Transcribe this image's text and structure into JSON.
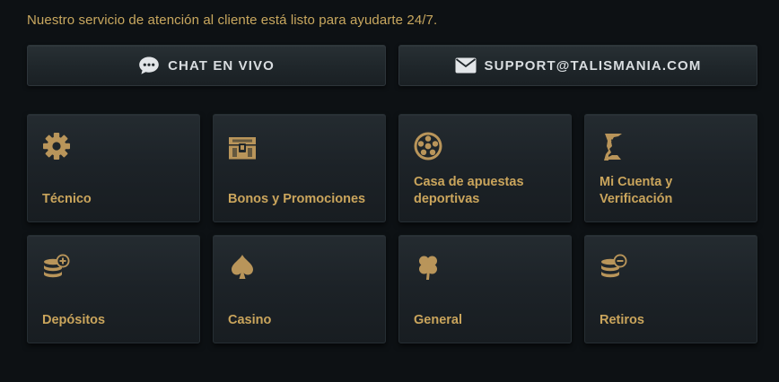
{
  "intro_text": "Nuestro servicio de atención al cliente está listo para ayudarte 24/7.",
  "contact_buttons": {
    "chat": {
      "label": "CHAT EN VIVO",
      "icon": "chat-bubble-icon"
    },
    "email": {
      "label": "SUPPORT@TALISMANIA.COM",
      "icon": "envelope-icon"
    }
  },
  "categories": [
    {
      "label": "Técnico",
      "icon": "gear-icon"
    },
    {
      "label": "Bonos y Promociones",
      "icon": "treasure-chest-icon"
    },
    {
      "label": "Casa de apuestas deportivas",
      "icon": "soccer-ball-icon"
    },
    {
      "label": "Mi Cuenta y Verificación",
      "icon": "pharaoh-bust-icon"
    },
    {
      "label": "Depósitos",
      "icon": "coin-stack-plus-icon"
    },
    {
      "label": "Casino",
      "icon": "spade-icon"
    },
    {
      "label": "General",
      "icon": "clover-icon"
    },
    {
      "label": "Retiros",
      "icon": "coin-stack-minus-icon"
    }
  ],
  "colors": {
    "background": "#0d1114",
    "accent_gold": "#c9a85f",
    "button_text": "#d9dde0",
    "icon_gold": "#b9955a"
  }
}
